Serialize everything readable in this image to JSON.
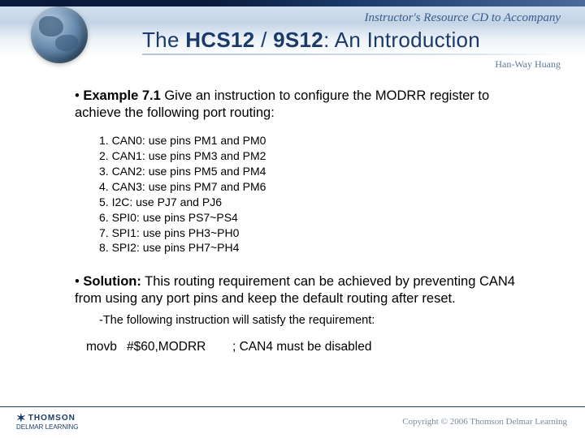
{
  "header": {
    "tagline": "Instructor's Resource CD to Accompany",
    "title_pre": "The ",
    "title_bold1": "HCS12",
    "title_mid": " / ",
    "title_bold2": "9S12",
    "title_post": ": An Introduction",
    "author": "Han-Way Huang"
  },
  "example": {
    "bullet": "• ",
    "label": "Example 7.1",
    "text": " Give an instruction to configure the MODRR register to achieve the following port routing:"
  },
  "list": [
    "1. CAN0: use pins PM1 and PM0",
    "2. CAN1: use pins PM3 and PM2",
    "3. CAN2: use pins PM5 and PM4",
    "4. CAN3: use pins PM7 and PM6",
    "5. I2C: use PJ7 and PJ6",
    "6. SPI0: use pins PS7~PS4",
    "7. SPI1: use pins PH3~PH0",
    "8. SPI2: use pins PH7~PH4"
  ],
  "solution": {
    "bullet": "• ",
    "label": "Solution:",
    "text": " This routing requirement can be achieved by preventing CAN4 from using any port pins and keep the default routing after reset.",
    "note": "-The following instruction will satisfy the requirement:"
  },
  "code": {
    "op": "movb",
    "arg": "#$60,MODRR",
    "comment": "; CAN4 must be disabled"
  },
  "footer": {
    "brand": "THOMSON",
    "sub": "DELMAR LEARNING",
    "copyright": "Copyright © 2006 Thomson Delmar Learning"
  }
}
